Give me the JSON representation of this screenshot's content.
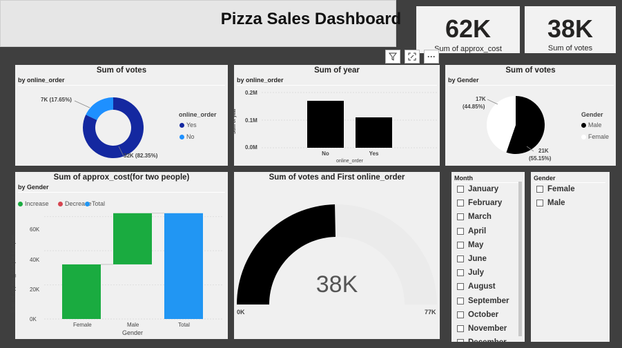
{
  "header": {
    "title": "Pizza Sales Dashboard"
  },
  "kpis": [
    {
      "value": "62K",
      "label": "Sum of approx_cost"
    },
    {
      "value": "38K",
      "label": "Sum of votes"
    }
  ],
  "toolbar": {
    "icons": [
      "filter-icon",
      "focus-mode-icon",
      "more-options-icon"
    ],
    "more_glyph": "···"
  },
  "donut": {
    "title": "Sum of votes",
    "subtitle": "by online_order",
    "legend_title": "online_order",
    "colors": {
      "yes": "#1428a0",
      "no": "#1e90ff"
    },
    "labels": {
      "no": "7K (17.65%)",
      "yes": "32K (82.35%)"
    },
    "legend": [
      "Yes",
      "No"
    ]
  },
  "bar_year": {
    "title": "Sum of year",
    "subtitle": "by online_order",
    "ylabel": "Sum of year",
    "xlabel": "online_order",
    "yticks": [
      "0.2M",
      "0.1M",
      "0.0M"
    ]
  },
  "pie_gender": {
    "title": "Sum of votes",
    "subtitle": "by Gender",
    "legend_title": "Gender",
    "legend": [
      "Male",
      "Female"
    ],
    "labels": {
      "female": "17K",
      "female_pct": "(44.85%)",
      "male": "21K",
      "male_pct": "(55.15%)"
    }
  },
  "waterfall": {
    "title": "Sum of approx_cost(for two people)",
    "subtitle": "by Gender",
    "legend": [
      "Increase",
      "Decrease",
      "Total"
    ],
    "ylabel": "Sum of approx_cost(for two peo...",
    "xlabel": "Gender",
    "yticks": [
      "60K",
      "40K",
      "20K",
      "0K"
    ],
    "colors": {
      "increase": "#1aab40",
      "decrease": "#d64550",
      "total": "#2196f3"
    }
  },
  "gauge": {
    "title": "Sum of votes and First online_order",
    "value_label": "38K",
    "min_label": "0K",
    "max_label": "77K",
    "fraction": 0.4935
  },
  "month_slicer": {
    "title": "Month",
    "items": [
      "January",
      "February",
      "March",
      "April",
      "May",
      "June",
      "July",
      "August",
      "September",
      "October",
      "November",
      "December"
    ]
  },
  "gender_slicer": {
    "title": "Gender",
    "items": [
      "Female",
      "Male"
    ]
  },
  "chart_data": [
    {
      "type": "pie",
      "title": "Sum of votes",
      "subtitle": "by online_order",
      "categories": [
        "Yes",
        "No"
      ],
      "values": [
        32000,
        7000
      ],
      "percent": [
        82.35,
        17.65
      ]
    },
    {
      "type": "bar",
      "title": "Sum of year",
      "subtitle": "by online_order",
      "categories": [
        "No",
        "Yes"
      ],
      "values": [
        170000,
        110000
      ],
      "xlabel": "online_order",
      "ylabel": "Sum of year",
      "ylim": [
        0,
        200000
      ]
    },
    {
      "type": "pie",
      "title": "Sum of votes",
      "subtitle": "by Gender",
      "categories": [
        "Male",
        "Female"
      ],
      "values": [
        21000,
        17000
      ],
      "percent": [
        55.15,
        44.85
      ]
    },
    {
      "type": "bar",
      "title": "Sum of approx_cost(for two people)",
      "subtitle": "by Gender",
      "categories": [
        "Female",
        "Male",
        "Total"
      ],
      "values": [
        32000,
        30000,
        62000
      ],
      "xlabel": "Gender",
      "ylabel": "Sum of approx_cost(for two peo...",
      "ylim": [
        0,
        70000
      ]
    }
  ]
}
